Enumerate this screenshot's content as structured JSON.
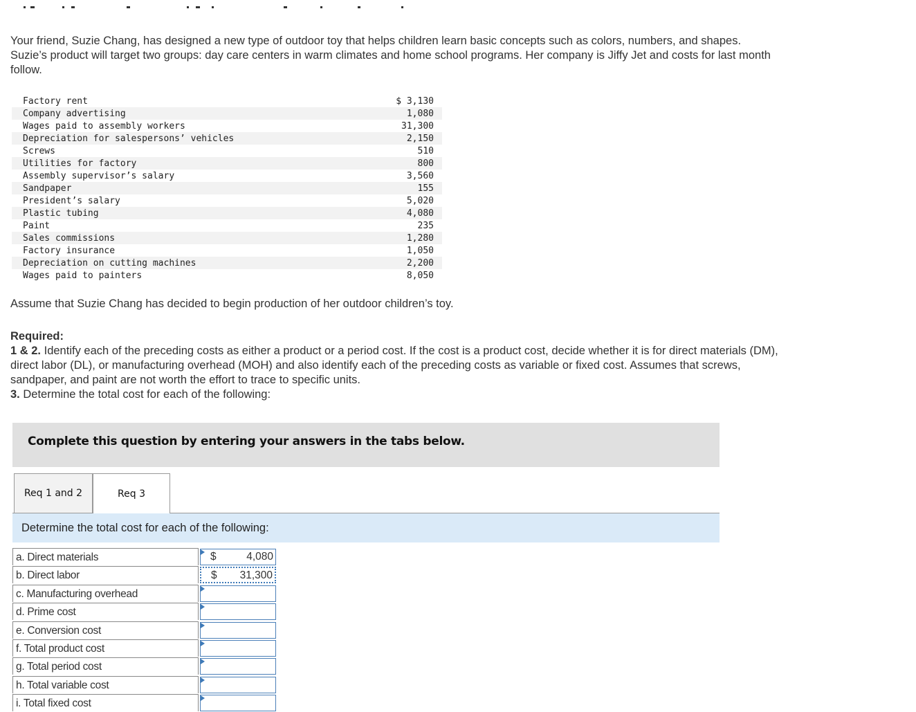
{
  "intro": "Your friend, Suzie Chang, has designed a new type of outdoor toy that helps children learn basic concepts such as colors, numbers, and shapes. Suzie’s product will target two groups: day care centers in warm climates and home school programs. Her company is Jiffy Jet and costs for last month follow.",
  "costs": [
    {
      "item": "Factory rent",
      "amount": "$ 3,130"
    },
    {
      "item": "Company advertising",
      "amount": "1,080"
    },
    {
      "item": "Wages paid to assembly workers",
      "amount": "31,300"
    },
    {
      "item": "Depreciation for salespersons’ vehicles",
      "amount": "2,150"
    },
    {
      "item": "Screws",
      "amount": "510"
    },
    {
      "item": "Utilities for factory",
      "amount": "800"
    },
    {
      "item": "Assembly supervisor’s salary",
      "amount": "3,560"
    },
    {
      "item": "Sandpaper",
      "amount": "155"
    },
    {
      "item": "President’s salary",
      "amount": "5,020"
    },
    {
      "item": "Plastic tubing",
      "amount": "4,080"
    },
    {
      "item": "Paint",
      "amount": "235"
    },
    {
      "item": "Sales commissions",
      "amount": "1,280"
    },
    {
      "item": "Factory insurance",
      "amount": "1,050"
    },
    {
      "item": "Depreciation on cutting machines",
      "amount": "2,200"
    },
    {
      "item": "Wages paid to painters",
      "amount": "8,050"
    }
  ],
  "assume": "Assume that Suzie Chang has decided to begin production of her outdoor children’s toy.",
  "required": {
    "heading": "Required:",
    "req12_label": "1 & 2.",
    "req12_text": " Identify each of the preceding costs as either a product or a period cost. If the cost is a product cost, decide whether it is for direct materials (DM), direct labor (DL), or manufacturing overhead (MOH) and also identify each of the preceding costs as variable or fixed cost. Assumes that screws, sandpaper, and paint are not worth the effort to trace to specific units.",
    "req3_label": "3.",
    "req3_text": " Determine the total cost for each of the following:"
  },
  "banner": "Complete this question by entering your answers in the tabs below.",
  "tabs": [
    {
      "label": "Req 1 and 2",
      "active": false
    },
    {
      "label": "Req 3",
      "active": true
    }
  ],
  "instruction": "Determine the total cost for each of the following:",
  "answers": [
    {
      "label": "a. Direct materials",
      "currency": "$",
      "value": "4,080"
    },
    {
      "label": "b. Direct labor",
      "currency": "$",
      "value": "31,300"
    },
    {
      "label": "c. Manufacturing overhead",
      "currency": "",
      "value": ""
    },
    {
      "label": "d. Prime cost",
      "currency": "",
      "value": ""
    },
    {
      "label": "e. Conversion cost",
      "currency": "",
      "value": ""
    },
    {
      "label": "f. Total product cost",
      "currency": "",
      "value": ""
    },
    {
      "label": "g. Total period cost",
      "currency": "",
      "value": ""
    },
    {
      "label": "h. Total variable cost",
      "currency": "",
      "value": ""
    },
    {
      "label": "i. Total fixed cost",
      "currency": "",
      "value": ""
    }
  ]
}
